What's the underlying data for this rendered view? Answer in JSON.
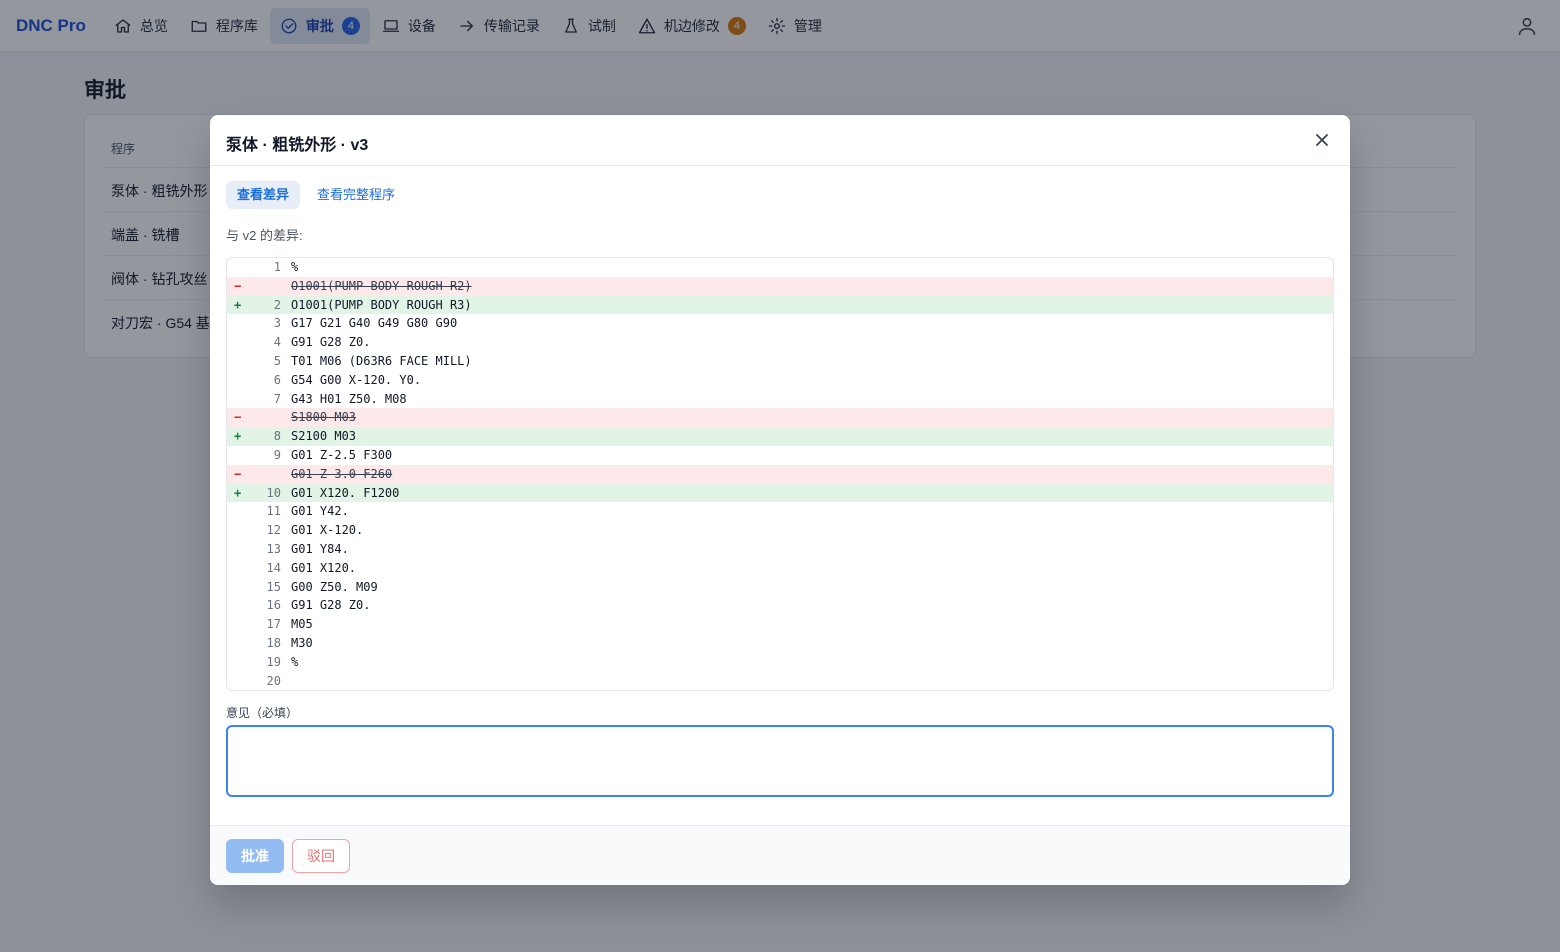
{
  "brand": "DNC Pro",
  "nav": [
    {
      "label": "总览",
      "icon": "home-icon"
    },
    {
      "label": "程序库",
      "icon": "folder-icon"
    },
    {
      "label": "审批",
      "icon": "check-circle-icon",
      "badge": "4",
      "active": true
    },
    {
      "label": "设备",
      "icon": "monitor-icon"
    },
    {
      "label": "传输记录",
      "icon": "arrow-right-icon"
    },
    {
      "label": "试制",
      "icon": "flask-icon"
    },
    {
      "label": "机边修改",
      "icon": "warning-icon",
      "badge": "4"
    },
    {
      "label": "管理",
      "icon": "gear-icon"
    }
  ],
  "page": {
    "title": "审批",
    "table_header": "程序",
    "rows": [
      "泵体 · 粗铣外形",
      "端盖 · 铣槽",
      "阀体 · 钻孔攻丝",
      "对刀宏 · G54 基"
    ]
  },
  "modal": {
    "title": "泵体 · 粗铣外形 · v3",
    "tabs": [
      "查看差异",
      "查看完整程序"
    ],
    "diff_caption": "与 v2 的差异:",
    "diff": [
      {
        "type": "ctx",
        "num": "1",
        "code": "%"
      },
      {
        "type": "del",
        "num": "",
        "code": "O1001(PUMP BODY ROUGH R2)"
      },
      {
        "type": "add",
        "num": "2",
        "code": "O1001(PUMP BODY ROUGH R3)"
      },
      {
        "type": "ctx",
        "num": "3",
        "code": "G17 G21 G40 G49 G80 G90"
      },
      {
        "type": "ctx",
        "num": "4",
        "code": "G91 G28 Z0."
      },
      {
        "type": "ctx",
        "num": "5",
        "code": "T01 M06 (D63R6 FACE MILL)"
      },
      {
        "type": "ctx",
        "num": "6",
        "code": "G54 G00 X-120. Y0."
      },
      {
        "type": "ctx",
        "num": "7",
        "code": "G43 H01 Z50. M08"
      },
      {
        "type": "del",
        "num": "",
        "code": "S1800 M03"
      },
      {
        "type": "add",
        "num": "8",
        "code": "S2100 M03"
      },
      {
        "type": "ctx",
        "num": "9",
        "code": "G01 Z-2.5 F300"
      },
      {
        "type": "del",
        "num": "",
        "code": "G01 Z-3.0 F260"
      },
      {
        "type": "add",
        "num": "10",
        "code": "G01 X120. F1200"
      },
      {
        "type": "ctx",
        "num": "11",
        "code": "G01 Y42."
      },
      {
        "type": "ctx",
        "num": "12",
        "code": "G01 X-120."
      },
      {
        "type": "ctx",
        "num": "13",
        "code": "G01 Y84."
      },
      {
        "type": "ctx",
        "num": "14",
        "code": "G01 X120."
      },
      {
        "type": "ctx",
        "num": "15",
        "code": "G00 Z50. M09"
      },
      {
        "type": "ctx",
        "num": "16",
        "code": "G91 G28 Z0."
      },
      {
        "type": "ctx",
        "num": "17",
        "code": "M05"
      },
      {
        "type": "ctx",
        "num": "18",
        "code": "M30"
      },
      {
        "type": "ctx",
        "num": "19",
        "code": "%"
      },
      {
        "type": "ctx",
        "num": "20",
        "code": ""
      }
    ],
    "comment_label": "意见（必填）",
    "comment_value": "",
    "approve_label": "批准",
    "reject_label": "驳回"
  }
}
